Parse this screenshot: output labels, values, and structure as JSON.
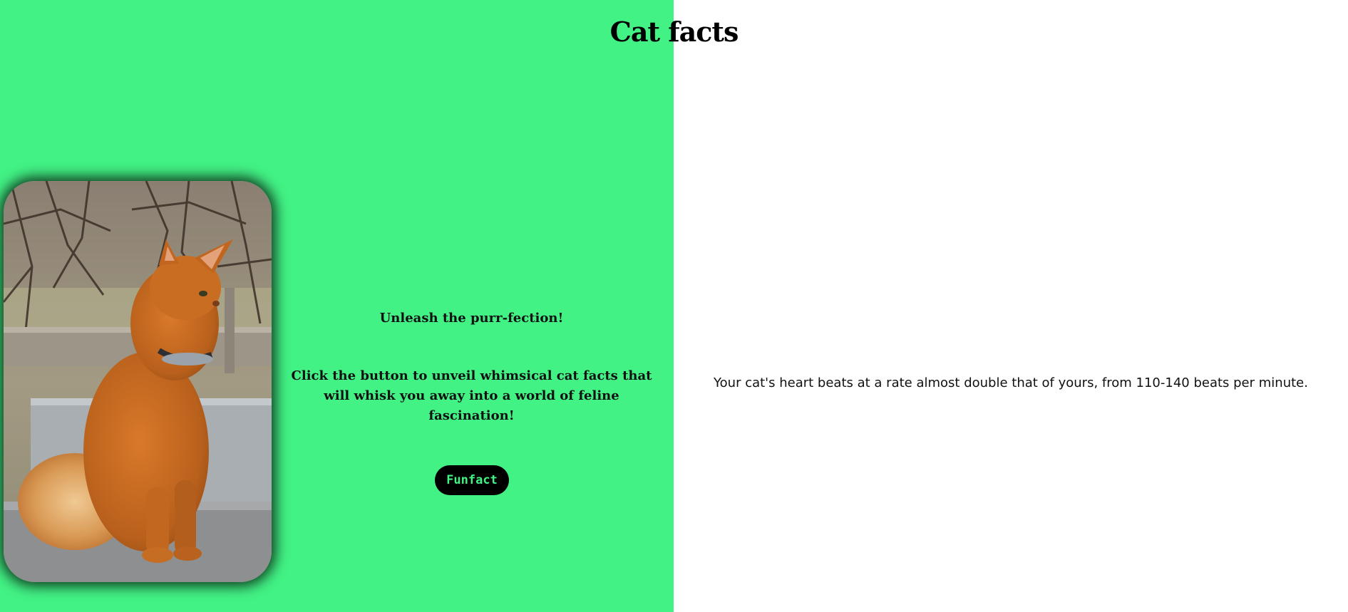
{
  "header": {
    "title": "Cat facts"
  },
  "hero": {
    "tagline": "Unleash the purr-fection!",
    "description": "Click the button to unveil whimsical cat facts that will whisk you away into a world of feline fascination!",
    "button_label": "Funfact"
  },
  "fact": {
    "text": "Your cat's heart beats at a rate almost double that of yours, from 110-140 beats per minute."
  },
  "colors": {
    "accent": "#42f285",
    "button_bg": "#000000",
    "right_bg": "#ffffff"
  }
}
